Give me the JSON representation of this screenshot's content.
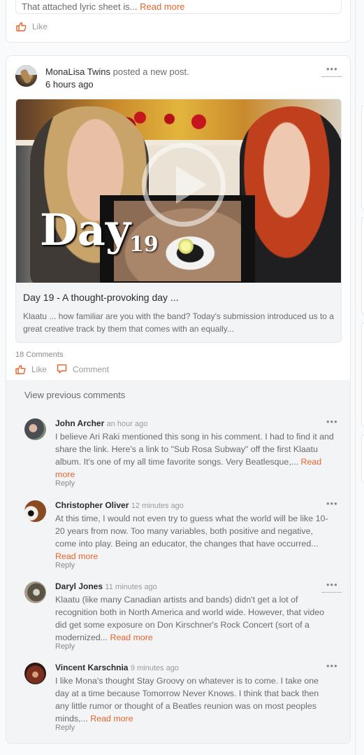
{
  "previous_post": {
    "quote_text": "That attached lyric sheet is...",
    "read_more": "Read more",
    "like_label": "Like"
  },
  "post": {
    "author": "MonaLisa Twins",
    "action": "posted a new post.",
    "time": "6 hours ago",
    "more_icon": "ellipsis-icon",
    "link_preview": {
      "thumbnail_text_day": "Day",
      "thumbnail_text_number": "19",
      "play_icon": "play-circle-icon",
      "title": "Day 19 - A thought-provoking day ...",
      "description": "Klaatu ... how familiar are you with the band? Today's submission introduced us to a great creative track by them that comes with an equally..."
    },
    "comment_count": "18 Comments",
    "like_label": "Like",
    "comment_label": "Comment"
  },
  "comments": {
    "view_previous": "View previous comments",
    "items": [
      {
        "author": "John Archer",
        "time": "an hour ago",
        "body": "I believe Ari Raki mentioned this song in his comment. I had to find it and share the link. Here's a link to \"Sub Rosa Subway\" off the first Klaatu album. It's one of my all time favorite songs. Very Beatlesque,...",
        "read_more": "Read more",
        "reply": "Reply"
      },
      {
        "author": "Christopher Oliver",
        "time": "12 minutes ago",
        "body": "At this time, I would not even try to guess what the world will be like 10-20 years from now. Too many variables, both positive and negative, come into play. Being an educator, the changes that have occurred...",
        "read_more": "Read more",
        "reply": "Reply"
      },
      {
        "author": "Daryl Jones",
        "time": "11 minutes ago",
        "body": "Klaatu (like many Canadian artists and bands) didn't get a lot of recognition both in North America and world wide. However, that video did get some exposure on Don Kirschner's Rock Concert (sort of a modernized...",
        "read_more": "Read more",
        "reply": "Reply"
      },
      {
        "author": "Vincent Karschnia",
        "time": "9 minutes ago",
        "body": "I like Mona's thought Stay Groovy on whatever is to come. I take one day at a time because Tomorrow Never Knows. I think that back then any little rumor or thought of a Beatles reunion was on most peoples minds,...",
        "read_more": "Read more",
        "reply": "Reply"
      }
    ]
  },
  "colors": {
    "accent": "#e8632b",
    "page_bg": "#f9fafb",
    "comments_bg": "#f3f4f6"
  }
}
